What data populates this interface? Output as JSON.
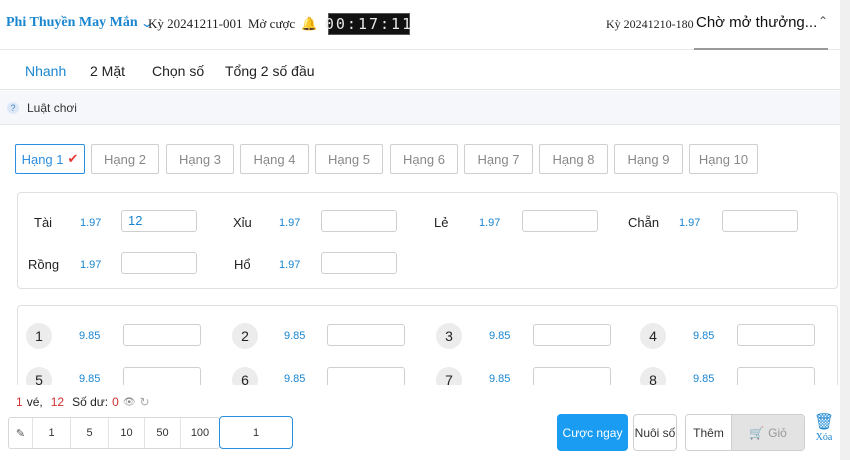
{
  "header": {
    "game_name": "Phi Thuyền May Mắn",
    "period": "Kỳ 20241211-001",
    "open_label": "Mở cược",
    "timer": "00:17:11",
    "prev_period": "Kỳ 20241210-180",
    "waiting": "Chờ mở thưởng..."
  },
  "tabs": [
    "Nhanh",
    "2 Mặt",
    "Chọn số",
    "Tổng 2 số đầu"
  ],
  "rules_label": "Luật chơi",
  "ranks": [
    "Hạng 1",
    "Hạng 2",
    "Hạng 3",
    "Hạng 4",
    "Hạng 5",
    "Hạng 6",
    "Hạng 7",
    "Hạng 8",
    "Hạng 9",
    "Hạng 10"
  ],
  "active_rank": "Hạng 1",
  "bet_options": [
    {
      "label": "Tài",
      "odds": "1.97",
      "value": "12"
    },
    {
      "label": "Xỉu",
      "odds": "1.97",
      "value": ""
    },
    {
      "label": "Lẻ",
      "odds": "1.97",
      "value": ""
    },
    {
      "label": "Chẵn",
      "odds": "1.97",
      "value": ""
    },
    {
      "label": "Rồng",
      "odds": "1.97",
      "value": ""
    },
    {
      "label": "Hổ",
      "odds": "1.97",
      "value": ""
    }
  ],
  "numbers": [
    {
      "num": "1",
      "odds": "9.85",
      "value": ""
    },
    {
      "num": "2",
      "odds": "9.85",
      "value": ""
    },
    {
      "num": "3",
      "odds": "9.85",
      "value": ""
    },
    {
      "num": "4",
      "odds": "9.85",
      "value": ""
    },
    {
      "num": "5",
      "odds": "9.85",
      "value": ""
    },
    {
      "num": "6",
      "odds": "9.85",
      "value": ""
    },
    {
      "num": "7",
      "odds": "9.85",
      "value": ""
    },
    {
      "num": "8",
      "odds": "9.85",
      "value": ""
    }
  ],
  "status": {
    "tickets": "1",
    "tickets_label": "vé,",
    "total": "12",
    "balance_label": "Số dư:",
    "balance": "0"
  },
  "chips": [
    "1",
    "5",
    "10",
    "50",
    "100"
  ],
  "amount": "1",
  "buttons": {
    "bet_now": "Cược ngay",
    "nuoi_so": "Nuôi số",
    "add": "Thêm",
    "cart": "Giỏ",
    "delete": "Xóa"
  }
}
